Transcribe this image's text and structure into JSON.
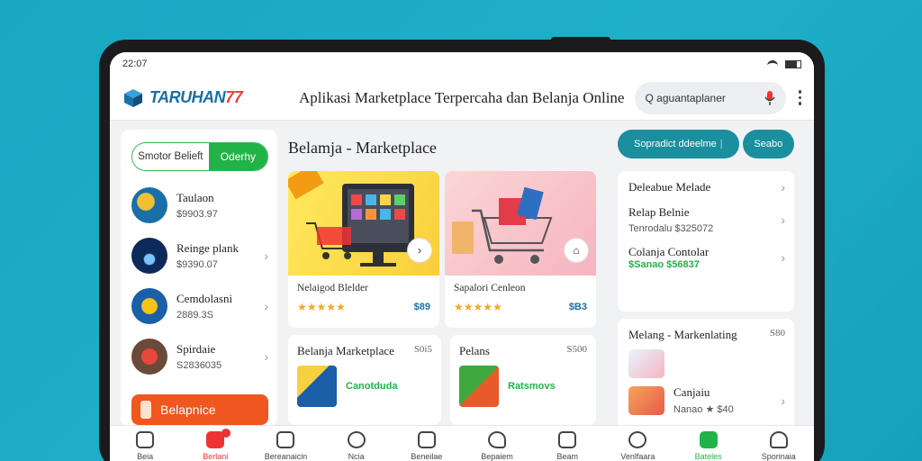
{
  "status": {
    "time": "22:07"
  },
  "header": {
    "brand": "TARUHAN",
    "brand_num": "77",
    "title": "Aplikasi Marketplace Terpercaha dan Belanja Online",
    "search_placeholder": "Q aguantaplaner"
  },
  "left": {
    "seg_a": "Smotor Belieft",
    "seg_b": "Oderhy",
    "sellers": [
      {
        "name": "Taulaon",
        "sub": "$9903.97"
      },
      {
        "name": "Reinge plank",
        "sub": "$9390.07"
      },
      {
        "name": "Cemdolasni",
        "sub": "2889.3S"
      },
      {
        "name": "Spirdaie",
        "sub": "S2836035"
      }
    ],
    "cta": "Belapnice"
  },
  "middle": {
    "title": "Belamja - Marketplace",
    "products": [
      {
        "name": "Nelaigod Blelder",
        "price": "$89"
      },
      {
        "name": "Sapalori Cenleon",
        "price": "$B3"
      }
    ],
    "small": [
      {
        "title": "Belanja Marketplace",
        "price": "S0i5",
        "tag": "Canotduda"
      },
      {
        "title": "Pelans",
        "price": "S500",
        "tag": "Ratsmovs"
      }
    ]
  },
  "right": {
    "btn_main": "Sopradict ddeelme",
    "btn_small": "Seabo",
    "info": [
      {
        "title": "Deleabue Melade",
        "sub": ""
      },
      {
        "title": "Relap Belnie",
        "sub": "Tenrodalu $325072"
      },
      {
        "title": "Colanja Contolar",
        "sub": "$Sanao $56837"
      }
    ],
    "trend_title": "Melang - Markenlating",
    "trend_price": "S80",
    "trend_item": {
      "name": "Canjaiu",
      "sub": "Nanao ★ $40"
    }
  },
  "nav": [
    "Beia",
    "Berlani",
    "Bereanaicin",
    "Ncia",
    "Beneilae",
    "Bepaiem",
    "Beam",
    "Venlfaara",
    "Bateles",
    "Sporinaia"
  ],
  "colors": {
    "accent_green": "#22b348",
    "accent_teal": "#1a8f9e",
    "brand_blue": "#1a6fa8",
    "cta_orange": "#f0561f"
  }
}
